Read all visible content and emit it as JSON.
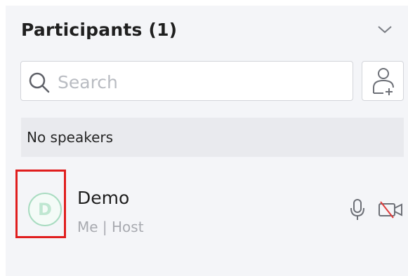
{
  "header": {
    "title": "Participants (1)",
    "collapse_icon": "chevron-down-icon"
  },
  "search": {
    "placeholder": "Search",
    "value": "",
    "icon": "search-icon"
  },
  "invite": {
    "icon": "add-user-icon"
  },
  "speakers": {
    "label": "No speakers"
  },
  "participants": [
    {
      "name": "Demo",
      "subtitle": "Me | Host",
      "avatar_letter": "D",
      "mic_icon": "microphone-icon",
      "camera_icon": "camera-off-icon"
    }
  ],
  "colors": {
    "highlight_border": "#e01e1e",
    "avatar_accent": "#a9dcc1",
    "panel_bg": "#f4f5f8",
    "camera_off": "#e03b3b"
  }
}
